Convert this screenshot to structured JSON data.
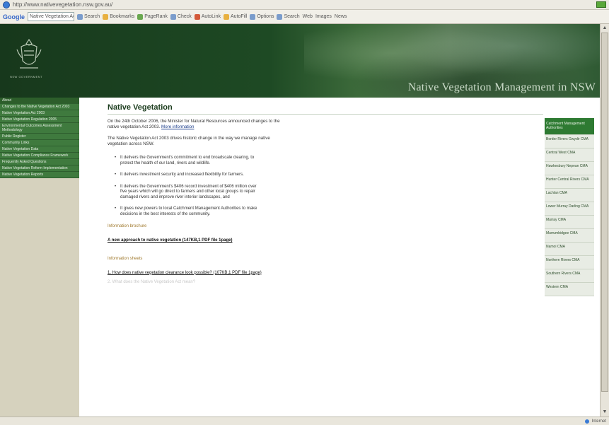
{
  "browser": {
    "url": "http://www.nativevegetation.nsw.gov.au/",
    "toolbar_logo": "Google",
    "search_value": "Native Vegetation Act",
    "toolbar_items": [
      "Search",
      "Bookmarks",
      "PageRank",
      "Check",
      "AutoLink",
      "AutoFill",
      "Options"
    ],
    "right_items": [
      "Search",
      "Web",
      "Images",
      "News"
    ],
    "status_text": "Internet"
  },
  "banner": {
    "title": "Native Vegetation Management in NSW",
    "crest_caption": "NSW GOVERNMENT"
  },
  "leftnav": {
    "items": [
      "About",
      "Changes to the Native Vegetation Act 2003",
      "Native Vegetation Act 2003",
      "Native Vegetation Regulation 2005",
      "Environmental Outcomes Assessment Methodology",
      "Public Register",
      "Community Links",
      "Native Vegetation Data",
      "Native Vegetation Compliance Framework",
      "Frequently Asked Questions",
      "Native Vegetation Reform Implementation",
      "Native Vegetation Reports"
    ]
  },
  "main": {
    "title": "Native Vegetation",
    "intro": "On the 24th October 2006, the Minister for Natural Resources announced changes to the native vegetation Act 2003.",
    "intro_link": "More information",
    "intro2": "The Native Vegetation Act 2003 drives historic change in the way we manage native vegetation across NSW.",
    "bullets": [
      "It delivers the Government's commitment to end broadscale clearing, to protect the health of our land, rivers and wildlife.",
      "It delivers investment security and increased flexibility for farmers.",
      "It delivers the Government's $406 record investment of $406 million over five years which will go direct to farmers and other local groups to repair damaged rivers and improve river interior landscapes, and",
      "It gives new powers to local Catchment Management Authorities to make decisions in the best interests of the community."
    ],
    "section1": "Information brochure",
    "doc1": "A new approach to native vegetation (147KB,1 PDF file 1page)",
    "section2": "Information sheets",
    "doc2": "1. How does native vegetation clearance look possible? (107KB,1 PDF file 1page)",
    "faded": "2. What does the Native Vegetation Act mean?"
  },
  "rightnav": {
    "items": [
      "Catchment Management Authorities",
      "Border Rivers Gwydir CMA",
      "Central West CMA",
      "Hawkesbury Nepean CMA",
      "Hunter Central Rivers CMA",
      "Lachlan CMA",
      "Lower Murray Darling CMA",
      "Murray CMA",
      "Murrumbidgee CMA",
      "Namoi CMA",
      "Northern Rivers CMA",
      "Southern Rivers CMA",
      "Western CMA"
    ]
  },
  "colors": {
    "banner_dark": "#17381c",
    "nav_green": "#3f7a3e",
    "active_green": "#2e7a32",
    "sidebar_bg": "#d6d2be",
    "heading": "#1b3c1d",
    "section": "#a07a2e"
  }
}
